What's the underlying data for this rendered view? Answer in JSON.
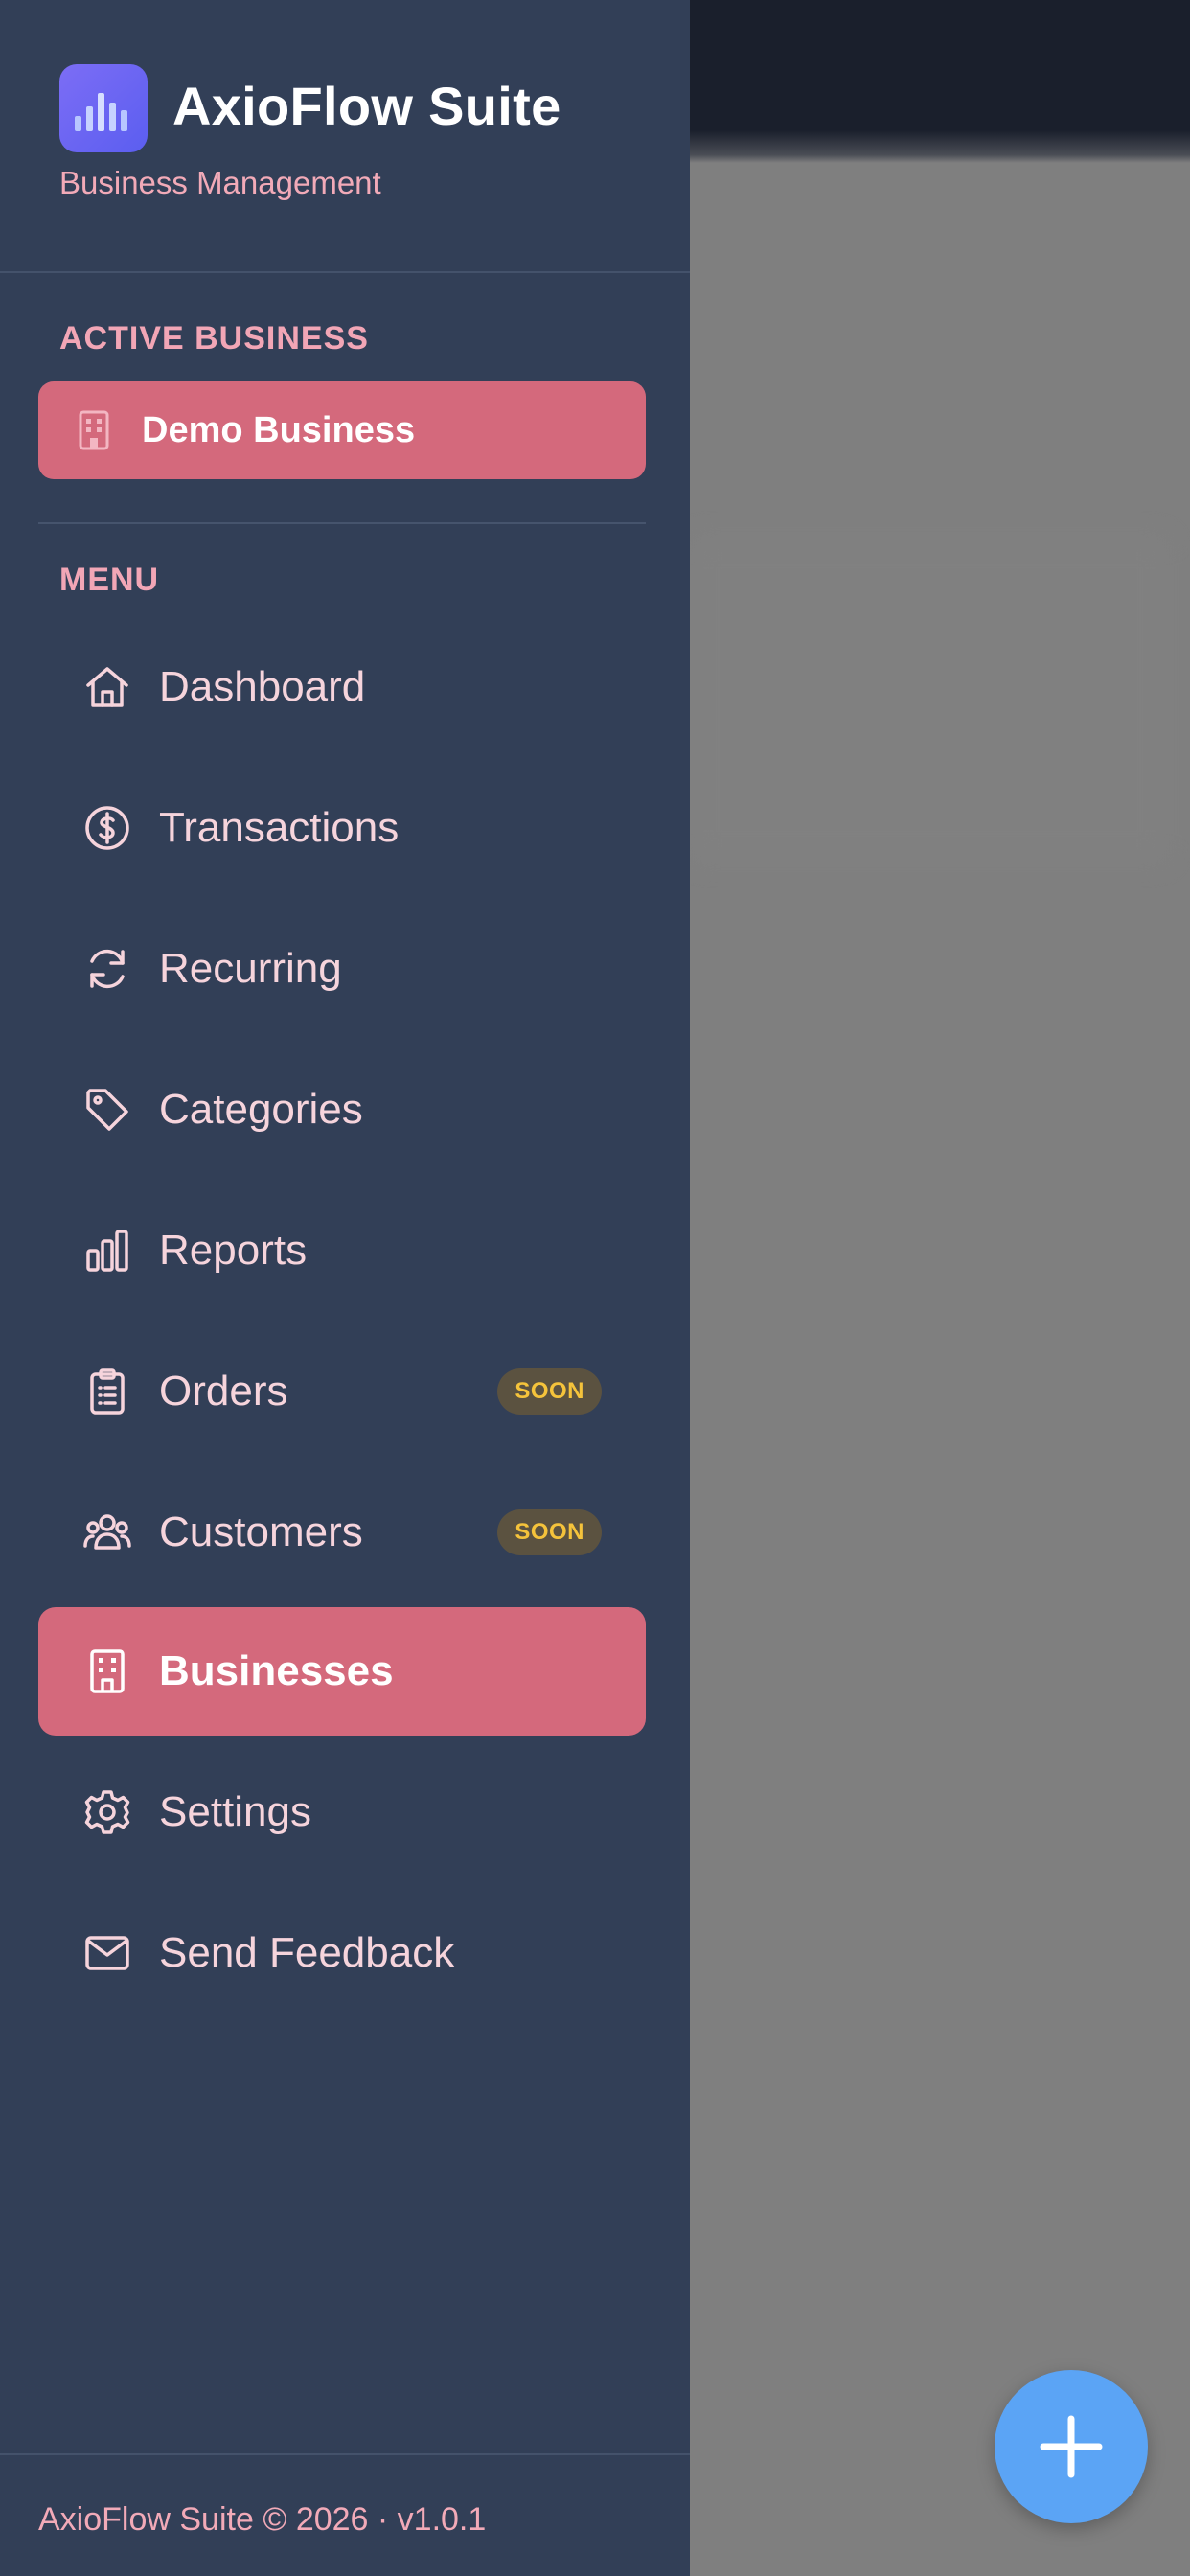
{
  "app": {
    "name": "AxioFlow Suite",
    "subtitle": "Business Management"
  },
  "active_business": {
    "section_label": "ACTIVE BUSINESS",
    "name": "Demo Business"
  },
  "menu": {
    "section_label": "MENU",
    "items": [
      {
        "label": "Dashboard",
        "icon": "home-icon",
        "active": false
      },
      {
        "label": "Transactions",
        "icon": "dollar-circle-icon",
        "active": false
      },
      {
        "label": "Recurring",
        "icon": "refresh-icon",
        "active": false
      },
      {
        "label": "Categories",
        "icon": "tag-icon",
        "active": false
      },
      {
        "label": "Reports",
        "icon": "bar-chart-icon",
        "active": false
      },
      {
        "label": "Orders",
        "icon": "clipboard-list-icon",
        "active": false,
        "badge": "SOON"
      },
      {
        "label": "Customers",
        "icon": "users-icon",
        "active": false,
        "badge": "SOON"
      },
      {
        "label": "Businesses",
        "icon": "building-icon",
        "active": true
      },
      {
        "label": "Settings",
        "icon": "gear-icon",
        "active": false
      },
      {
        "label": "Send Feedback",
        "icon": "mail-icon",
        "active": false
      }
    ]
  },
  "footer": {
    "text": "AxioFlow Suite © 2026 · v1.0.1"
  },
  "fab": {
    "icon": "plus-icon"
  },
  "colors": {
    "drawer_bg": "#323f57",
    "accent": "#d4697c",
    "fab": "#5ba4f5",
    "badge_text": "#f5c33b"
  }
}
